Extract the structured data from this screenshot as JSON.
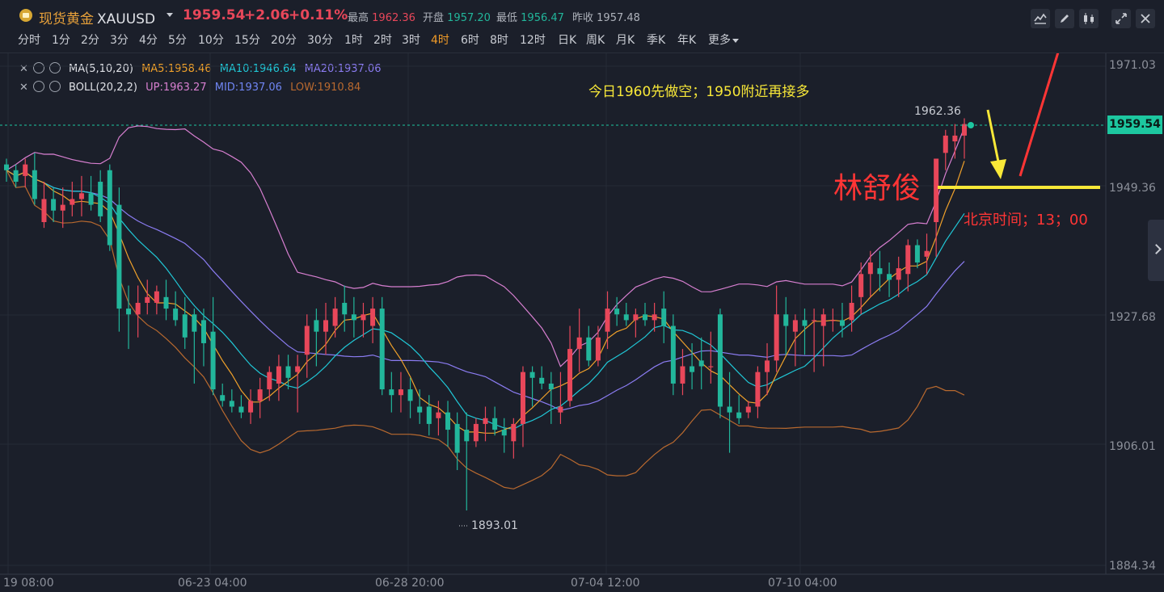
{
  "header": {
    "name": "现货黄金",
    "code": "XAUUSD",
    "price": "1959.54",
    "change": "+2.06",
    "change_pct": "+0.11%",
    "high_label": "最高",
    "high": "1962.36",
    "open_label": "开盘",
    "open": "1957.20",
    "low_label": "最低",
    "low": "1956.47",
    "prev_label": "昨收",
    "prev": "1957.48",
    "icons": [
      "indicator-icon",
      "draw-icon",
      "candle-type-icon",
      "fullscreen-icon",
      "close-icon"
    ]
  },
  "timeframes": [
    "分时",
    "1分",
    "2分",
    "3分",
    "4分",
    "5分",
    "10分",
    "15分",
    "20分",
    "30分",
    "1时",
    "2时",
    "3时",
    "4时",
    "6时",
    "8时",
    "12时",
    "日K",
    "周K",
    "月K",
    "季K",
    "年K",
    "更多"
  ],
  "active_timeframe": "4时",
  "indicators": {
    "ma": {
      "name": "MA(5,10,20)",
      "ma5": "MA5:1958.46",
      "ma10": "MA10:1946.64",
      "ma20": "MA20:1937.06"
    },
    "boll": {
      "name": "BOLL(20,2,2)",
      "up": "UP:1963.27",
      "mid": "MID:1937.06",
      "low": "LOW:1910.84"
    }
  },
  "colors": {
    "up": "#e8475a",
    "down": "#22b69b",
    "ma5": "#f0a12a",
    "ma10": "#20c7d6",
    "ma20": "#8b7cf2",
    "boll_up": "#d77fd0",
    "boll_low": "#b8692f",
    "note": "#f8e838",
    "signature": "#ff3535"
  },
  "price_axis": [
    "1971.03",
    "1949.36",
    "1927.68",
    "1906.01",
    "1884.34"
  ],
  "current_price_tag": "1959.54",
  "time_axis": [
    "19 08:00",
    "06-23 04:00",
    "06-28 20:00",
    "07-04 12:00",
    "07-10 04:00"
  ],
  "annotations": {
    "note1": "今日1960先做空；1950附近再接多",
    "signature": "林舒俊",
    "note2": "北京时间；13；00",
    "high_mark": "1962.36",
    "low_mark": "1893.01"
  },
  "chart_data": {
    "type": "candlestick",
    "ylim": [
      1884.34,
      1971.03
    ],
    "candles": [
      [
        1954,
        1955,
        1951,
        1953
      ],
      [
        1953,
        1954,
        1950,
        1951
      ],
      [
        1952,
        1955,
        1950,
        1954
      ],
      [
        1953,
        1956,
        1947,
        1948
      ],
      [
        1944,
        1951,
        1943,
        1948
      ],
      [
        1948,
        1950,
        1944,
        1946
      ],
      [
        1946,
        1950,
        1943,
        1947
      ],
      [
        1947,
        1951,
        1945,
        1948
      ],
      [
        1948,
        1952,
        1945,
        1949
      ],
      [
        1949,
        1952,
        1946,
        1947
      ],
      [
        1951,
        1953,
        1944,
        1945
      ],
      [
        1953,
        1954,
        1939,
        1940
      ],
      [
        1947,
        1950,
        1925,
        1929
      ],
      [
        1929,
        1933,
        1922,
        1928
      ],
      [
        1928,
        1933,
        1924,
        1930
      ],
      [
        1930,
        1934,
        1928,
        1931
      ],
      [
        1930,
        1933,
        1928,
        1932
      ],
      [
        1931,
        1934,
        1927,
        1929
      ],
      [
        1929,
        1932,
        1926,
        1927
      ],
      [
        1928,
        1931,
        1922,
        1924
      ],
      [
        1928,
        1929,
        1916,
        1925
      ],
      [
        1927,
        1929,
        1919,
        1923
      ],
      [
        1925,
        1931,
        1914,
        1915
      ],
      [
        1914,
        1916,
        1912,
        1913
      ],
      [
        1913,
        1915,
        1911,
        1912
      ],
      [
        1912,
        1914,
        1910,
        1911
      ],
      [
        1911,
        1915,
        1909,
        1913
      ],
      [
        1913,
        1917,
        1910,
        1915
      ],
      [
        1915,
        1919,
        1913,
        1918
      ],
      [
        1916,
        1921,
        1913,
        1919
      ],
      [
        1919,
        1921,
        1915,
        1917
      ],
      [
        1918,
        1921,
        1911,
        1919
      ],
      [
        1921,
        1928,
        1917,
        1926
      ],
      [
        1927,
        1929,
        1919,
        1925
      ],
      [
        1925,
        1930,
        1921,
        1927
      ],
      [
        1926,
        1931,
        1924,
        1929
      ],
      [
        1930,
        1933,
        1925,
        1928
      ],
      [
        1928,
        1931,
        1924,
        1927
      ],
      [
        1927,
        1930,
        1924,
        1928
      ],
      [
        1926,
        1931,
        1923,
        1929
      ],
      [
        1929,
        1931,
        1914,
        1915
      ],
      [
        1915,
        1918,
        1911,
        1914
      ],
      [
        1914,
        1918,
        1911,
        1915
      ],
      [
        1915,
        1917,
        1910,
        1913
      ],
      [
        1912,
        1915,
        1909,
        1911
      ],
      [
        1912,
        1914,
        1907,
        1909
      ],
      [
        1910,
        1913,
        1907,
        1911
      ],
      [
        1911,
        1913,
        1905,
        1908
      ],
      [
        1909,
        1911,
        1901,
        1904
      ],
      [
        1908,
        1911,
        1894,
        1906
      ],
      [
        1906,
        1910,
        1905,
        1909
      ],
      [
        1909,
        1912,
        1906,
        1910
      ],
      [
        1910,
        1912,
        1907,
        1908
      ],
      [
        1908,
        1910,
        1904,
        1907
      ],
      [
        1906,
        1910,
        1903,
        1909
      ],
      [
        1909,
        1919,
        1905,
        1918
      ],
      [
        1918,
        1919,
        1912,
        1917
      ],
      [
        1917,
        1919,
        1915,
        1916
      ],
      [
        1916,
        1918,
        1909,
        1915
      ],
      [
        1911,
        1918,
        1909,
        1912
      ],
      [
        1913,
        1926,
        1912,
        1922
      ],
      [
        1922,
        1929,
        1918,
        1924
      ],
      [
        1924,
        1926,
        1919,
        1920
      ],
      [
        1920,
        1926,
        1919,
        1924
      ],
      [
        1925,
        1932,
        1922,
        1929
      ],
      [
        1929,
        1931,
        1926,
        1928
      ],
      [
        1928,
        1930,
        1926,
        1927
      ],
      [
        1927,
        1929,
        1924,
        1928
      ],
      [
        1928,
        1930,
        1926,
        1927
      ],
      [
        1927,
        1930,
        1925,
        1928
      ],
      [
        1929,
        1932,
        1923,
        1926
      ],
      [
        1926,
        1928,
        1914,
        1916
      ],
      [
        1916,
        1922,
        1914,
        1919
      ],
      [
        1919,
        1923,
        1915,
        1918
      ],
      [
        1920,
        1924,
        1915,
        1919
      ],
      [
        1919,
        1925,
        1916,
        1919
      ],
      [
        1928,
        1929,
        1910,
        1912
      ],
      [
        1912,
        1918,
        1904,
        1911
      ],
      [
        1911,
        1914,
        1909,
        1910
      ],
      [
        1911,
        1913,
        1910,
        1912
      ],
      [
        1912,
        1919,
        1910,
        1918
      ],
      [
        1918,
        1923,
        1914,
        1920
      ],
      [
        1920,
        1933,
        1918,
        1928
      ],
      [
        1928,
        1931,
        1921,
        1926
      ],
      [
        1925,
        1928,
        1919,
        1927
      ],
      [
        1927,
        1929,
        1921,
        1926
      ],
      [
        1927,
        1929,
        1918,
        1927
      ],
      [
        1926,
        1929,
        1919,
        1928
      ],
      [
        1927,
        1929,
        1925,
        1927
      ],
      [
        1927,
        1930,
        1924,
        1926
      ],
      [
        1927,
        1933,
        1925,
        1930
      ],
      [
        1931,
        1937,
        1928,
        1935
      ],
      [
        1935,
        1939,
        1931,
        1937
      ],
      [
        1936,
        1939,
        1932,
        1935
      ],
      [
        1935,
        1937,
        1931,
        1934
      ],
      [
        1934,
        1938,
        1931,
        1936
      ],
      [
        1935,
        1941,
        1932,
        1940
      ],
      [
        1940,
        1941,
        1936,
        1937
      ],
      [
        1938,
        1942,
        1935,
        1939
      ],
      [
        1944,
        1955,
        1938,
        1955
      ],
      [
        1956,
        1960,
        1953,
        1959
      ],
      [
        1958,
        1961,
        1955,
        1959
      ],
      [
        1959,
        1962,
        1955,
        1961
      ]
    ],
    "ma5_series_label": "MA5",
    "ma10_series_label": "MA10",
    "ma20_series_label": "MA20"
  }
}
